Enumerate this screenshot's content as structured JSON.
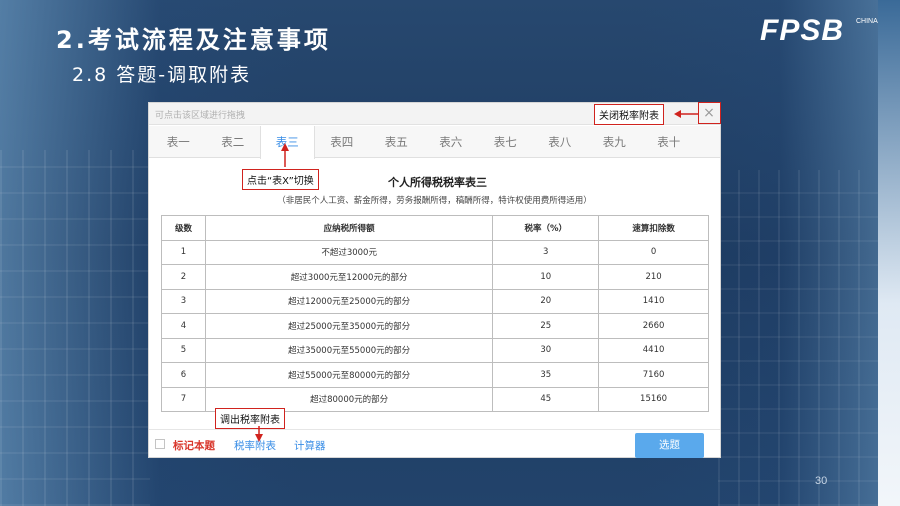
{
  "slide": {
    "title": "2.考试流程及注意事项",
    "subtitle": "2.8  答题-调取附表",
    "logo": "FPSB",
    "logo_sub": "CHINA",
    "page_number": "30"
  },
  "window": {
    "drag_hint": "可点击该区域进行拖拽",
    "close_icon": "×",
    "tabs": [
      "表一",
      "表二",
      "表三",
      "表四",
      "表五",
      "表六",
      "表七",
      "表八",
      "表九",
      "表十"
    ],
    "active_tab": 2,
    "table_title": "个人所得税税率表三",
    "table_subtitle": "（非居民个人工资、薪金所得，劳务报酬所得，稿酬所得，特许权使用费所得适用）",
    "table": {
      "headers": [
        "级数",
        "应纳税所得额",
        "税率（%）",
        "速算扣除数"
      ],
      "rows": [
        [
          "1",
          "不超过3000元",
          "3",
          "0"
        ],
        [
          "2",
          "超过3000元至12000元的部分",
          "10",
          "210"
        ],
        [
          "3",
          "超过12000元至25000元的部分",
          "20",
          "1410"
        ],
        [
          "4",
          "超过25000元至35000元的部分",
          "25",
          "2660"
        ],
        [
          "5",
          "超过35000元至55000元的部分",
          "30",
          "4410"
        ],
        [
          "6",
          "超过55000元至80000元的部分",
          "35",
          "7160"
        ],
        [
          "7",
          "超过80000元的部分",
          "45",
          "15160"
        ]
      ]
    },
    "footer": {
      "mark_label": "标记本题",
      "rate_link": "税率附表",
      "calc_link": "计算器",
      "answer_button": "选题"
    }
  },
  "callouts": {
    "close": "关闭税率附表",
    "switch": "点击“表X”切换",
    "open": "调出税率附表"
  },
  "colors": {
    "accent_blue": "#3a8ee6",
    "callout_red": "#d0231e",
    "mark_red": "#d9372c",
    "button_blue": "#5aa9ec"
  }
}
